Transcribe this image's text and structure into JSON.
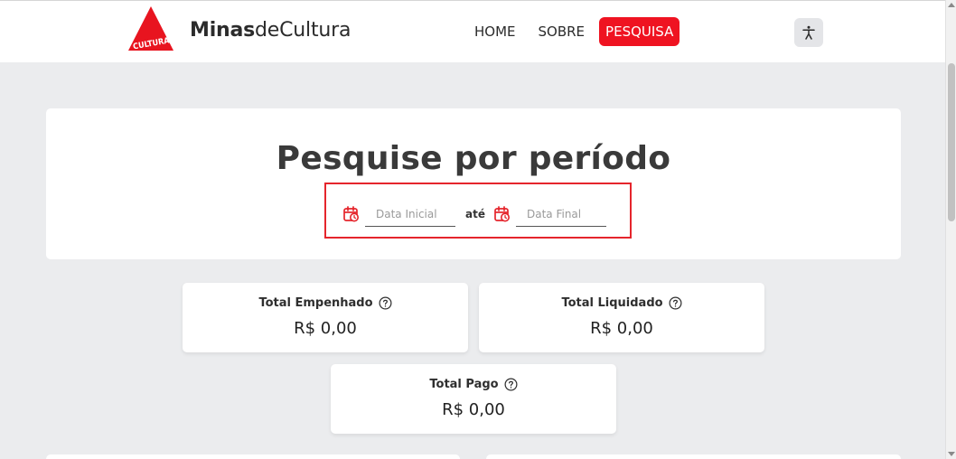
{
  "header": {
    "brand_bold": "Minas",
    "brand_rest": "deCultura",
    "logo_text": "CULTURA",
    "nav": {
      "home": "HOME",
      "sobre": "SOBRE",
      "pesquisa": "PESQUISA"
    },
    "accessibility_icon": "accessibility-person-icon"
  },
  "search": {
    "title": "Pesquise por período",
    "start_placeholder": "Data Inicial",
    "separator": "até",
    "end_placeholder": "Data Final",
    "calendar_icon": "calendar-clock-icon"
  },
  "stats": {
    "empenhado": {
      "label": "Total Empenhado",
      "value": "R$ 0,00"
    },
    "liquidado": {
      "label": "Total Liquidado",
      "value": "R$ 0,00"
    },
    "pago": {
      "label": "Total Pago",
      "value": "R$ 0,00"
    }
  },
  "colors": {
    "accent": "#ef1321",
    "background": "#ebecee",
    "card": "#ffffff"
  }
}
